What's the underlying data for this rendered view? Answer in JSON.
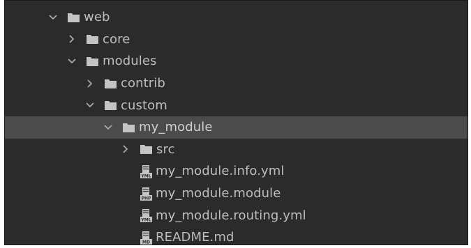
{
  "tree": {
    "items": [
      {
        "label": "web",
        "kind": "folder",
        "state": "expanded",
        "depth": 0
      },
      {
        "label": "core",
        "kind": "folder",
        "state": "collapsed",
        "depth": 1
      },
      {
        "label": "modules",
        "kind": "folder",
        "state": "expanded",
        "depth": 1
      },
      {
        "label": "contrib",
        "kind": "folder",
        "state": "collapsed",
        "depth": 2
      },
      {
        "label": "custom",
        "kind": "folder",
        "state": "expanded",
        "depth": 2
      },
      {
        "label": "my_module",
        "kind": "folder",
        "state": "expanded",
        "depth": 3,
        "selected": true
      },
      {
        "label": "src",
        "kind": "folder",
        "state": "collapsed",
        "depth": 4
      },
      {
        "label": "my_module.info.yml",
        "kind": "file",
        "badge": "YML",
        "depth": 4
      },
      {
        "label": "my_module.module",
        "kind": "file",
        "badge": "PHP",
        "depth": 4
      },
      {
        "label": "my_module.routing.yml",
        "kind": "file",
        "badge": "YML",
        "depth": 4
      },
      {
        "label": "README.md",
        "kind": "file",
        "badge": "MD",
        "depth": 4
      }
    ]
  },
  "colors": {
    "background": "#2b2b2b",
    "selection": "#4b4b4b",
    "text": "#bdbdbd",
    "icon": "#c9c9c9"
  }
}
